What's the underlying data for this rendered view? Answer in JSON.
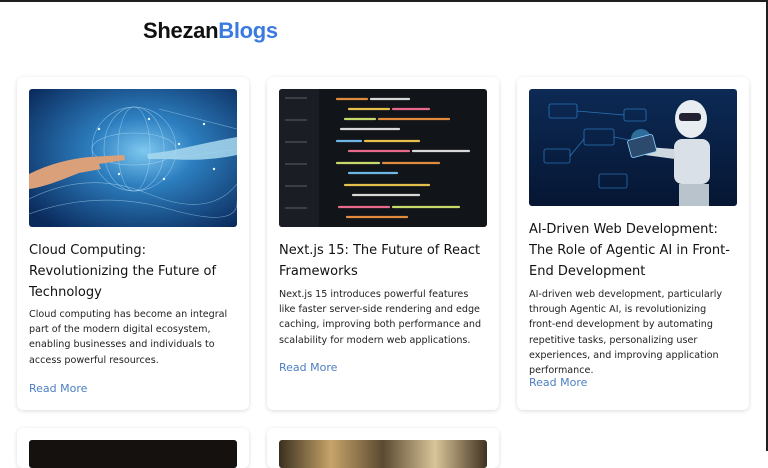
{
  "brand": {
    "part1": "Shezan",
    "part2": "Blogs"
  },
  "posts": [
    {
      "title": "Cloud Computing: Revolutionizing the Future of Technology",
      "excerpt": "Cloud computing has become an integral part of the modern digital ecosystem, enabling businesses and individuals to access powerful resources.",
      "cta": "Read More",
      "image": "cloud-computing-hand-network-image"
    },
    {
      "title": "Next.js 15: The Future of React Frameworks",
      "excerpt": "Next.js 15 introduces powerful features like faster server-side rendering and edge caching, improving both performance and scalability for modern web applications.",
      "cta": "Read More",
      "image": "code-on-screen-image"
    },
    {
      "title": "AI-Driven Web Development: The Role of Agentic AI in Front-End Development",
      "excerpt": "AI-driven web development, particularly through Agentic AI, is revolutionizing front-end development by automating repetitive tasks, personalizing user experiences, and improving application performance.",
      "cta": "Read More",
      "image": "robot-with-tablet-image"
    }
  ],
  "colors": {
    "brand_accent": "#3b7be0",
    "link": "#4a7fc1"
  }
}
